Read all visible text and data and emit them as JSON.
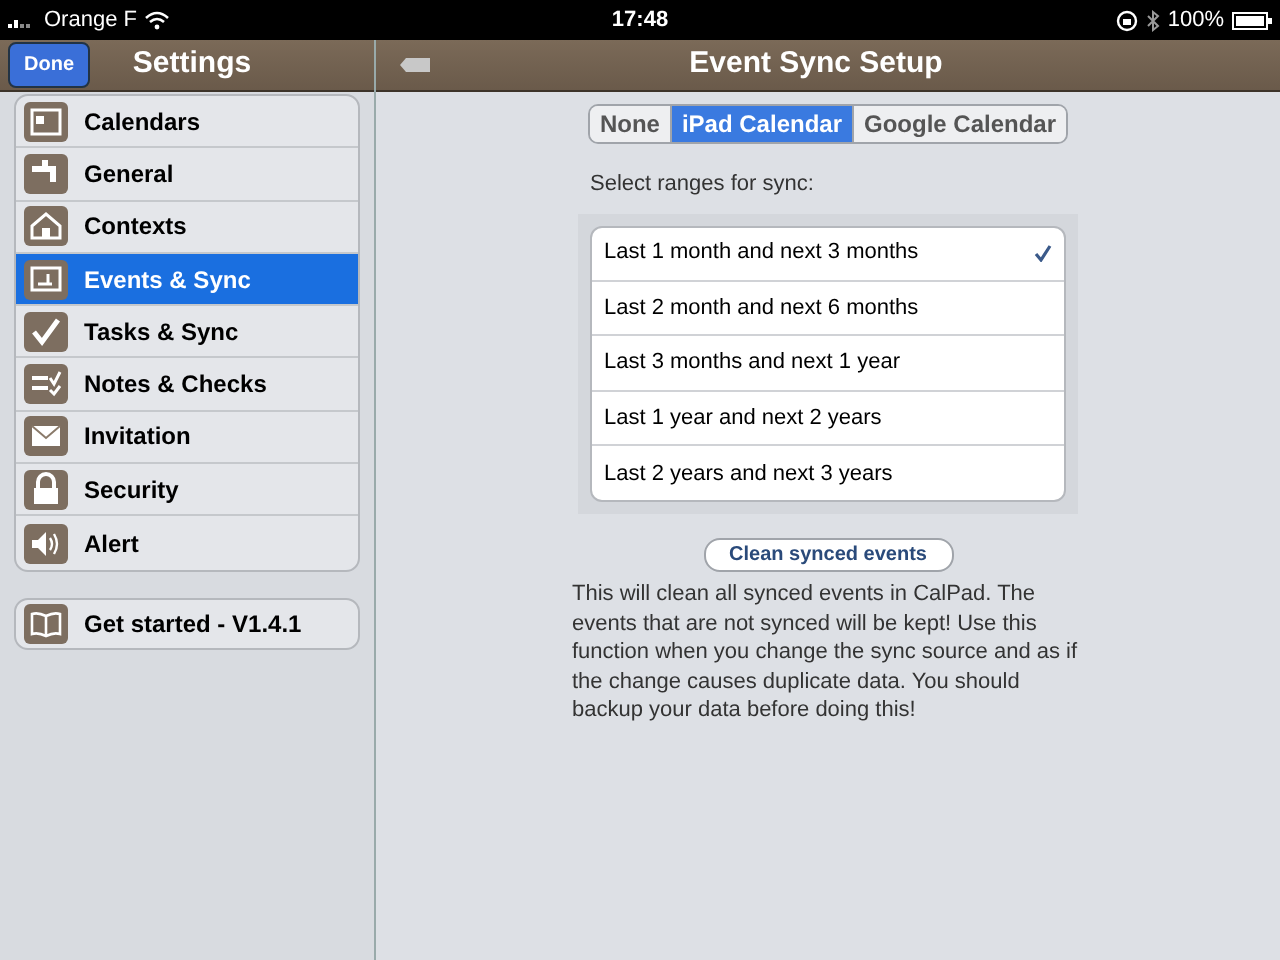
{
  "status_bar": {
    "carrier": "Orange F",
    "time": "17:48",
    "battery": "100%"
  },
  "sidebar": {
    "done_button": "Done",
    "title": "Settings",
    "items": [
      {
        "label": "Calendars",
        "selected": false
      },
      {
        "label": "General",
        "selected": false
      },
      {
        "label": "Contexts",
        "selected": false
      },
      {
        "label": "Events & Sync",
        "selected": true
      },
      {
        "label": "Tasks & Sync",
        "selected": false
      },
      {
        "label": "Notes & Checks",
        "selected": false
      },
      {
        "label": "Invitation",
        "selected": false
      },
      {
        "label": "Security",
        "selected": false
      },
      {
        "label": "Alert",
        "selected": false
      }
    ],
    "footer_item": {
      "label": "Get started - V1.4.1"
    }
  },
  "detail": {
    "title": "Event Sync Setup",
    "sources": [
      {
        "label": "None",
        "selected": false
      },
      {
        "label": "iPad Calendar",
        "selected": true
      },
      {
        "label": "Google Calendar",
        "selected": false
      }
    ],
    "ranges_label": "Select ranges for sync:",
    "ranges": [
      {
        "label": "Last 1 month and next 3 months",
        "selected": true
      },
      {
        "label": "Last 2 month and next 6 months",
        "selected": false
      },
      {
        "label": "Last 3 months and next 1 year",
        "selected": false
      },
      {
        "label": "Last 1 year and next 2 years",
        "selected": false
      },
      {
        "label": "Last 2 years and next 3 years",
        "selected": false
      }
    ],
    "clean_button": "Clean synced events",
    "note": "This will clean all synced events in CalPad. The events that are not synced will be kept! Use this function when you change the sync source and as if the change causes duplicate data. You should backup your data before doing this!"
  }
}
